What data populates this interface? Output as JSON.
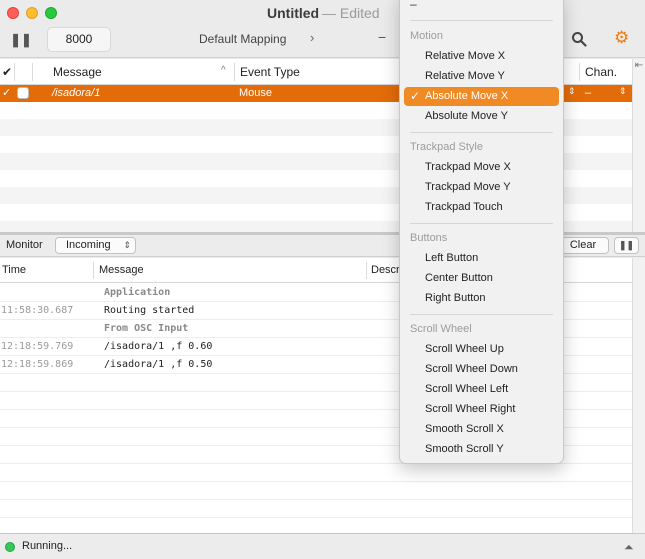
{
  "window": {
    "title": "Untitled",
    "edited_suffix": "— Edited"
  },
  "toolbar": {
    "pause_glyph": "❚❚",
    "port_value": "8000",
    "mapping_label": "Default Mapping",
    "mapping_next": "›",
    "minus": "−",
    "gear_glyph": "⚙"
  },
  "mapping_table": {
    "headers": {
      "check": "✔",
      "message": "Message",
      "sort_arrow": "^",
      "event_type": "Event Type",
      "channel": "Chan."
    },
    "rows": [
      {
        "message": "/isadora/1",
        "event_type": "Mouse",
        "channel": "–"
      }
    ]
  },
  "monitor": {
    "label": "Monitor",
    "direction": "Incoming",
    "clear_label": "Clear",
    "pause_glyph": "❚❚"
  },
  "log_table": {
    "headers": {
      "time": "Time",
      "message": "Message",
      "description": "Descr"
    },
    "rows": [
      {
        "time": "",
        "text": "Application",
        "group": true
      },
      {
        "time": "11:58:30.687",
        "text": "Routing started",
        "group": false
      },
      {
        "time": "",
        "text": "From OSC Input",
        "group": true
      },
      {
        "time": "12:18:59.769",
        "text": "/isadora/1 ,f 0.60",
        "group": false
      },
      {
        "time": "12:18:59.869",
        "text": "/isadora/1 ,f 0.50",
        "group": false
      }
    ]
  },
  "status": {
    "text": "Running...",
    "up_glyph": "⏶"
  },
  "menu": {
    "top_dash": "–",
    "sections": {
      "motion": "Motion",
      "trackpad": "Trackpad Style",
      "buttons": "Buttons",
      "scroll": "Scroll Wheel"
    },
    "items": {
      "relative_x": "Relative Move X",
      "relative_y": "Relative Move Y",
      "absolute_x": "Absolute Move X",
      "absolute_y": "Absolute Move Y",
      "trackpad_x": "Trackpad Move X",
      "trackpad_y": "Trackpad Move Y",
      "trackpad_touch": "Trackpad Touch",
      "left_button": "Left Button",
      "center_button": "Center Button",
      "right_button": "Right Button",
      "scroll_up": "Scroll Wheel Up",
      "scroll_down": "Scroll Wheel Down",
      "scroll_left": "Scroll Wheel Left",
      "scroll_right": "Scroll Wheel Right",
      "smooth_x": "Smooth Scroll X",
      "smooth_y": "Smooth Scroll Y"
    },
    "checked_item": "Absolute Move X"
  },
  "colors": {
    "accent": "#e36c09",
    "menu_highlight": "#f08a24",
    "running": "#34c759"
  }
}
